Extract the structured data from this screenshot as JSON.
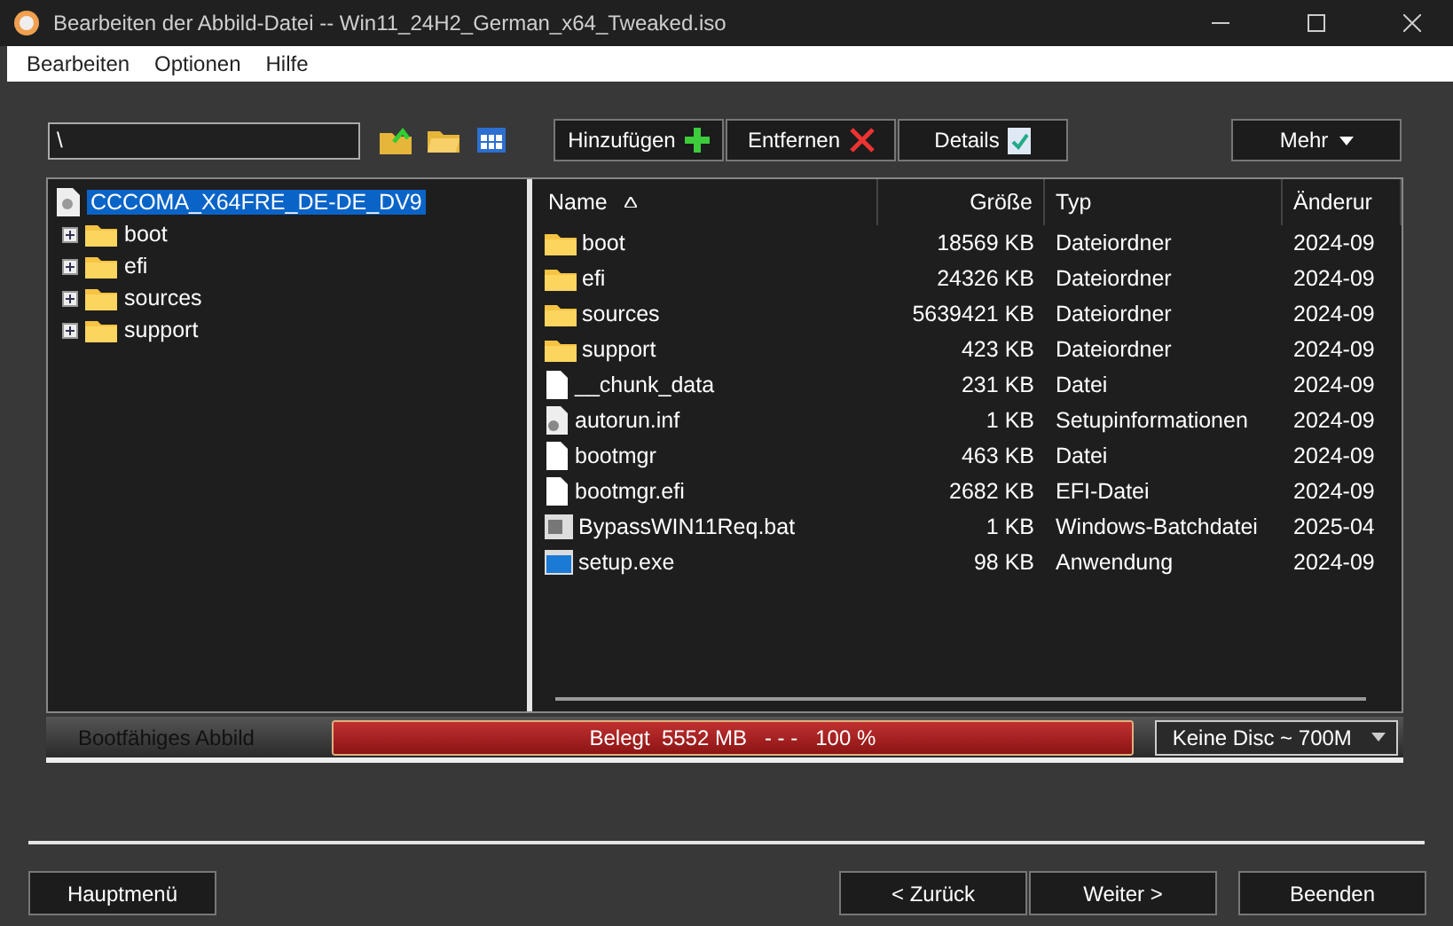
{
  "window": {
    "title": "Bearbeiten der Abbild-Datei -- Win11_24H2_German_x64_Tweaked.iso"
  },
  "menu": [
    "Bearbeiten",
    "Optionen",
    "Hilfe"
  ],
  "path_field": {
    "value": "\\"
  },
  "toolbar_buttons": [
    {
      "label": "Hinzufügen",
      "kind": "add"
    },
    {
      "label": "Entfernen",
      "kind": "remove"
    },
    {
      "label": "Details",
      "kind": "details"
    }
  ],
  "more_button": {
    "label": "Mehr"
  },
  "tree": {
    "label": "CCCOMA_X64FRE_DE-DE_DV9",
    "selected": true,
    "children": [
      {
        "label": "boot",
        "expanded": false
      },
      {
        "label": "efi",
        "expanded": false
      },
      {
        "label": "sources",
        "expanded": false
      },
      {
        "label": "support",
        "expanded": false
      }
    ]
  },
  "table": {
    "columns": [
      {
        "label": "Name",
        "sorted": true
      },
      {
        "label": "Größe",
        "sorted": false
      },
      {
        "label": "Typ",
        "sorted": false
      },
      {
        "label": "Änderur",
        "sorted": false
      }
    ],
    "rows": [
      {
        "kind": "folder",
        "name": "boot",
        "size": "18569 KB",
        "type": "Dateiordner",
        "modified": "2024-09"
      },
      {
        "kind": "folder",
        "name": "efi",
        "size": "24326 KB",
        "type": "Dateiordner",
        "modified": "2024-09"
      },
      {
        "kind": "folder",
        "name": "sources",
        "size": "5639421 KB",
        "type": "Dateiordner",
        "modified": "2024-09"
      },
      {
        "kind": "folder",
        "name": "support",
        "size": "423 KB",
        "type": "Dateiordner",
        "modified": "2024-09"
      },
      {
        "kind": "file",
        "name": "__chunk_data",
        "size": "231 KB",
        "type": "Datei",
        "modified": "2024-09"
      },
      {
        "kind": "setup",
        "name": "autorun.inf",
        "size": "1 KB",
        "type": "Setupinformationen",
        "modified": "2024-09"
      },
      {
        "kind": "file",
        "name": "bootmgr",
        "size": "463 KB",
        "type": "Datei",
        "modified": "2024-09"
      },
      {
        "kind": "file",
        "name": "bootmgr.efi",
        "size": "2682 KB",
        "type": "EFI-Datei",
        "modified": "2024-09"
      },
      {
        "kind": "batch",
        "name": "BypassWIN11Req.bat",
        "size": "1 KB",
        "type": "Windows-Batchdatei",
        "modified": "2025-04"
      },
      {
        "kind": "app",
        "name": "setup.exe",
        "size": "98 KB",
        "type": "Anwendung",
        "modified": "2024-09"
      }
    ]
  },
  "status": {
    "label": "Bootfähiges Abbild",
    "usage": {
      "text": "Belegt  5552 MB   - - -   100 %",
      "level": 1
    },
    "disc_select": {
      "value": "Keine Disc ~ 700M"
    }
  },
  "footer_buttons": [
    {
      "label": "Hauptmenü"
    },
    {
      "label": "< Zurück"
    },
    {
      "label": "Weiter >"
    },
    {
      "label": "Beenden"
    }
  ]
}
